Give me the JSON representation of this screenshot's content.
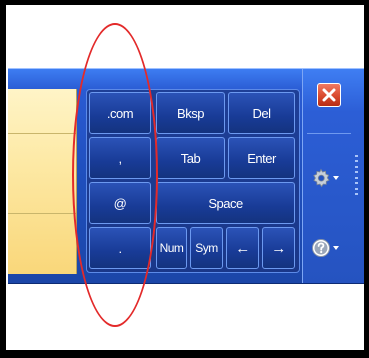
{
  "keyboard": {
    "symbol_keys": [
      ".com",
      ",",
      "@",
      "."
    ],
    "bksp": "Bksp",
    "del": "Del",
    "tab": "Tab",
    "enter": "Enter",
    "space": "Space",
    "num": "Num",
    "sym": "Sym",
    "left_arrow": "←",
    "right_arrow": "→"
  },
  "icons": {
    "close": "close-icon",
    "settings": "gear-icon",
    "help": "help-icon"
  },
  "colors": {
    "panel_blue": "#2553c0",
    "key_blue": "#183b96",
    "close_red": "#d94a2e",
    "highlight_circle": "#e32a2a",
    "tan_field": "#fde9a5"
  }
}
